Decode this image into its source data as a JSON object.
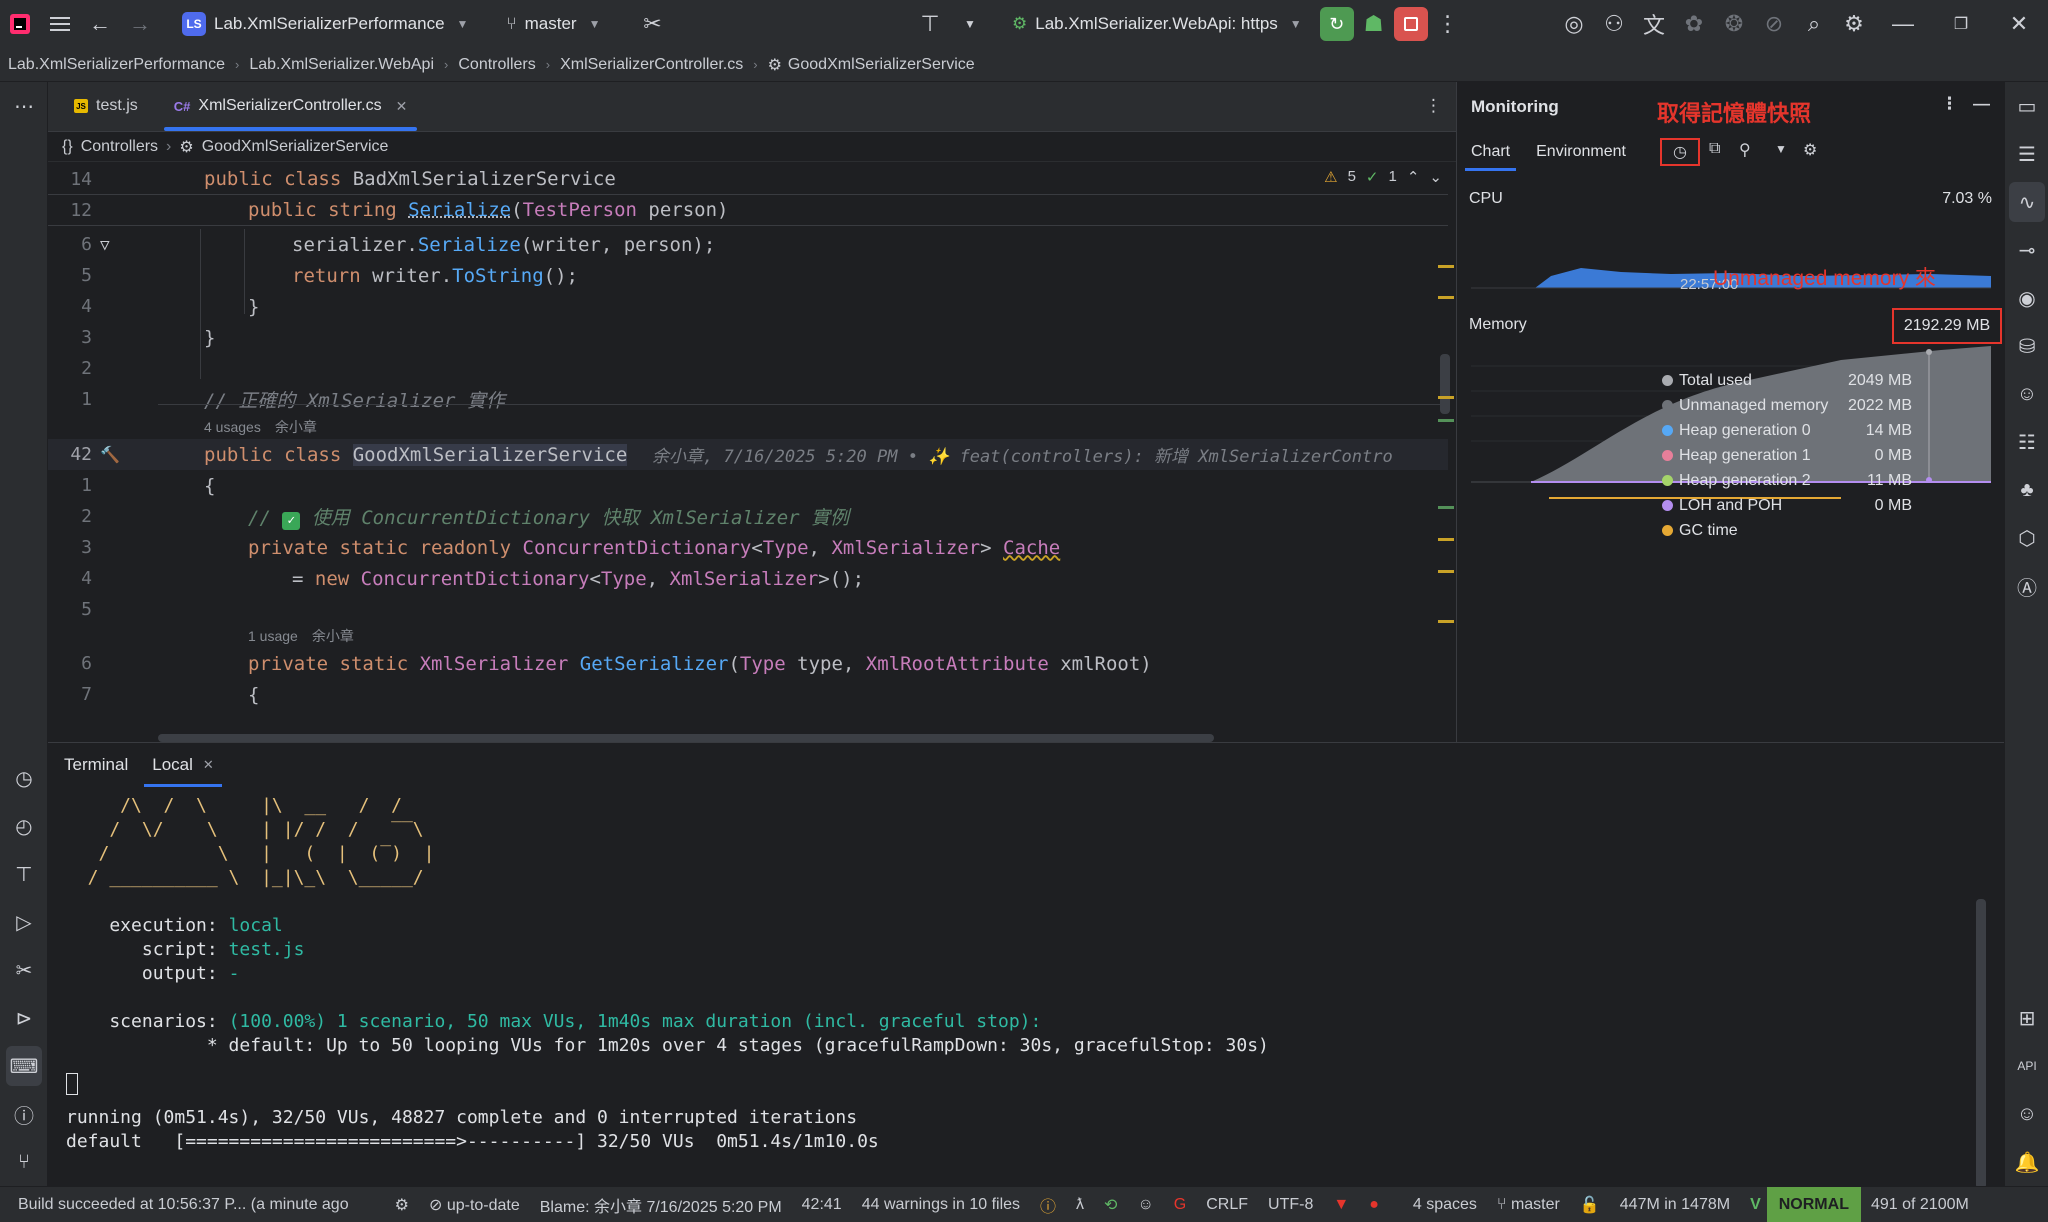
{
  "titlebar": {
    "project": "Lab.XmlSerializerPerformance",
    "project_badge": "LS",
    "branch": "master",
    "run_config": "Lab.XmlSerializer.WebApi: https"
  },
  "navbar": {
    "crumbs": [
      "Lab.XmlSerializerPerformance",
      "Lab.XmlSerializer.WebApi",
      "Controllers",
      "XmlSerializerController.cs",
      "GoodXmlSerializerService"
    ]
  },
  "editor": {
    "tabs": [
      {
        "label": "test.js"
      },
      {
        "label": "XmlSerializerController.cs"
      }
    ],
    "crumbs": [
      "Controllers",
      "GoodXmlSerializerService"
    ],
    "inspection_warn": "5",
    "inspection_ok": "1",
    "sticky": [
      {
        "ln": "14",
        "code": "public class BadXmlSerializerService"
      },
      {
        "ln": "12",
        "code": "public string Serialize(TestPerson person)"
      }
    ],
    "lines": [
      {
        "ln": "6"
      },
      {
        "ln": "5"
      },
      {
        "ln": "4"
      },
      {
        "ln": "3"
      },
      {
        "ln": "2"
      },
      {
        "ln": "1"
      },
      {
        "ln": "42"
      },
      {
        "ln": "1"
      },
      {
        "ln": "2"
      },
      {
        "ln": "3"
      },
      {
        "ln": "4"
      },
      {
        "ln": "5"
      },
      {
        "ln": "6"
      },
      {
        "ln": "7"
      }
    ],
    "hint1_usages": "4 usages",
    "hint1_author": "余小章",
    "hint2_usages": "1 usage",
    "hint2_author": "余小章",
    "blame_inline": "余小章, 7/16/2025 5:20 PM • ✨ feat(controllers): 新增 XmlSerializerContro",
    "comment1": "// 正確的 XmlSerializer 實作",
    "comment2": "使用 ConcurrentDictionary 快取 XmlSerializer 實例"
  },
  "monitor": {
    "title": "Monitoring",
    "snapshot_annotation": "取得記憶體快照",
    "tabs": [
      "Chart",
      "Environment"
    ],
    "cpu_label": "CPU",
    "cpu_value": "7.03 %",
    "time_label": "22:57:00",
    "unmanaged_annotation": "Unmanaged memory 來",
    "memory_label": "Memory",
    "memory_value": "2192.29 MB",
    "legend": [
      {
        "name": "Total used",
        "value": "2049 MB",
        "color": "#a9abb0"
      },
      {
        "name": "Unmanaged memory",
        "value": "2022 MB",
        "color": "#6e7278"
      },
      {
        "name": "Heap generation 0",
        "value": "14 MB",
        "color": "#56a8f5"
      },
      {
        "name": "Heap generation 1",
        "value": "0 MB",
        "color": "#e77f9a"
      },
      {
        "name": "Heap generation 2",
        "value": "11 MB",
        "color": "#a5d46a"
      },
      {
        "name": "LOH and POH",
        "value": "0 MB",
        "color": "#b48ef0"
      },
      {
        "name": "GC time",
        "value": "",
        "color": "#e5a834"
      }
    ]
  },
  "terminal": {
    "tabs": [
      "Terminal",
      "Local"
    ],
    "logo": [
      "     /\\  /  \\     |\\  __   /  /",
      "    /  \\/    \\    | |/ /  /   ‾‾\\",
      "   /          \\   |   (  |  (‾)  |",
      "  / __________ \\  |_|\\_\\  \\_____/"
    ],
    "exec_label": "    execution: ",
    "exec_value": "local",
    "script_label": "       script: ",
    "script_value": "test.js",
    "output_label": "       output: ",
    "output_value": "-",
    "scen_label": "    scenarios: ",
    "scen_value": "(100.00%) 1 scenario, 50 max VUs, 1m40s max duration (incl. graceful stop):",
    "scen_detail": "             * default: Up to 50 looping VUs for 1m20s over 4 stages (gracefulRampDown: 30s, gracefulStop: 30s)",
    "running": "running (0m51.4s), 32/50 VUs, 48827 complete and 0 interrupted iterations",
    "progress": "default   [=========================>----------] 32/50 VUs  0m51.4s/1m10.0s"
  },
  "status": {
    "build": "Build succeeded at 10:56:37 P... (a minute ago",
    "vcs": "up-to-date",
    "blame": "Blame: 余小章 7/16/2025 5:20 PM",
    "position": "42:41",
    "warnings": "44 warnings in 10 files",
    "line_sep": "CRLF",
    "encoding": "UTF-8",
    "indent": "4 spaces",
    "branch": "master",
    "memory": "447M in 1478M",
    "mode": "NORMAL",
    "heap": "491 of 2100M"
  }
}
